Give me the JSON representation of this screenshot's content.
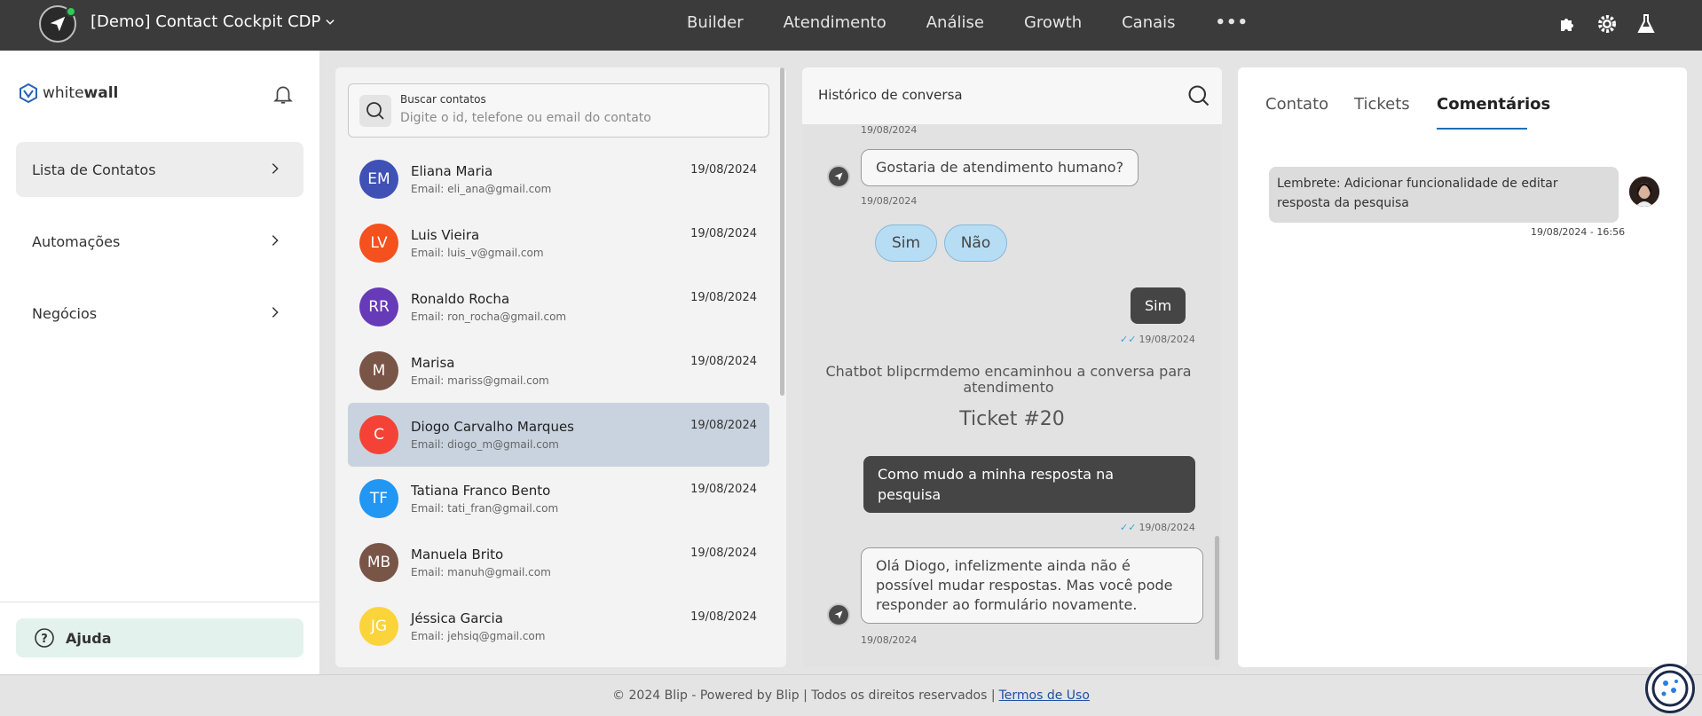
{
  "topbar": {
    "bot_name": "[Demo] Contact Cockpit CDP",
    "nav": [
      "Builder",
      "Atendimento",
      "Análise",
      "Growth",
      "Canais"
    ],
    "more": "•••",
    "icons": [
      "puzzle-icon",
      "gear-icon",
      "flask-icon"
    ]
  },
  "sidebar": {
    "brand_light": "white",
    "brand_bold": "wall",
    "items": [
      {
        "label": "Lista de Contatos",
        "active": true
      },
      {
        "label": "Automações",
        "active": false
      },
      {
        "label": "Negócios",
        "active": false
      }
    ],
    "help_label": "Ajuda"
  },
  "contacts": {
    "search_label": "Buscar contatos",
    "search_placeholder": "Digite o id, telefone ou email do contato",
    "items": [
      {
        "initials": "EM",
        "name": "Eliana Maria",
        "email": "Email: eli_ana@gmail.com",
        "date": "19/08/2024",
        "color": "#3f51b5"
      },
      {
        "initials": "LV",
        "name": "Luis Vieira",
        "email": "Email: luis_v@gmail.com",
        "date": "19/08/2024",
        "color": "#f4511e"
      },
      {
        "initials": "RR",
        "name": "Ronaldo Rocha",
        "email": "Email: ron_rocha@gmail.com",
        "date": "19/08/2024",
        "color": "#673ab7"
      },
      {
        "initials": "M",
        "name": "Marisa",
        "email": "Email: mariss@gmail.com",
        "date": "19/08/2024",
        "color": "#795548"
      },
      {
        "initials": "C",
        "name": "Diogo Carvalho Marques",
        "email": "Email: diogo_m@gmail.com",
        "date": "19/08/2024",
        "color": "#f44336",
        "selected": true
      },
      {
        "initials": "TF",
        "name": "Tatiana Franco Bento",
        "email": "Email: tati_fran@gmail.com",
        "date": "19/08/2024",
        "color": "#2196f3"
      },
      {
        "initials": "MB",
        "name": "Manuela Brito",
        "email": "Email: manuh@gmail.com",
        "date": "19/08/2024",
        "color": "#795548"
      },
      {
        "initials": "JG",
        "name": "Jéssica Garcia",
        "email": "Email: jehsiq@gmail.com",
        "date": "19/08/2024",
        "color": "#fbd43b"
      }
    ]
  },
  "conversation": {
    "title": "Histórico de conversa",
    "ts_top": "19/08/2024",
    "msg1": "Gostaria de atendimento humano?",
    "ts1": "19/08/2024",
    "quick_yes": "Sim",
    "quick_no": "Não",
    "reply1": "Sim",
    "ts_reply1": "19/08/2024",
    "system": "Chatbot blipcrmdemo encaminhou a conversa para atendimento",
    "ticket": "Ticket #20",
    "reply2": "Como mudo a minha resposta na pesquisa",
    "ts_reply2": "19/08/2024",
    "msg2": "Olá Diogo, infelizmente ainda não é possível mudar respostas. Mas você pode responder ao formulário novamente.",
    "ts2": "19/08/2024"
  },
  "details": {
    "tabs": [
      "Contato",
      "Tickets",
      "Comentários"
    ],
    "active_tab": "Comentários",
    "comment_text": "Lembrete: Adicionar funcionalidade de editar resposta da pesquisa",
    "comment_time": "19/08/2024 - 16:56"
  },
  "footer": {
    "text": "© 2024 Blip - Powered by Blip | Todos os direitos reservados |",
    "link": "Termos de Uso"
  },
  "colors": {
    "topbar": "#3b3b3b",
    "selected_row": "#c9d3df",
    "help_bg": "#e3f2ec",
    "tab_underline": "#1f6fb5",
    "out_bubble": "#454545",
    "quick_reply": "#b7ddf5"
  }
}
